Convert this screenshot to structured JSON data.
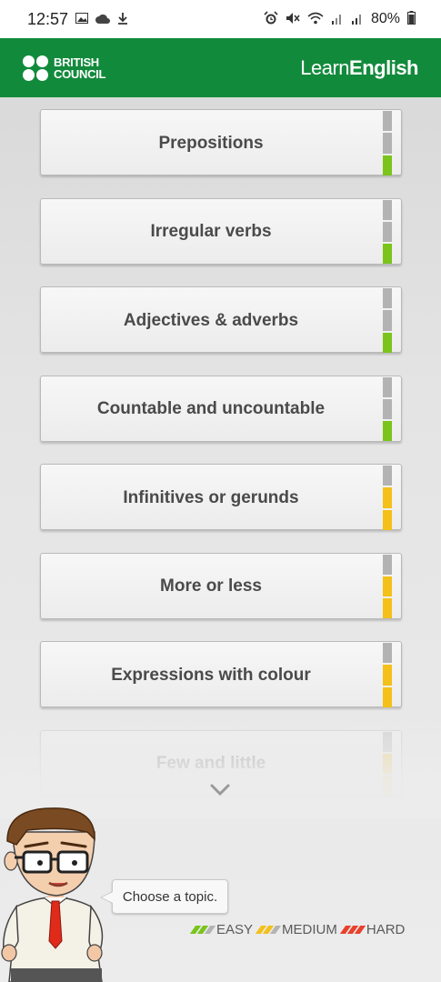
{
  "status_bar": {
    "time": "12:57",
    "battery": "80%",
    "left_icons": [
      "image-icon",
      "cloud-icon",
      "download-icon"
    ],
    "right_icons": [
      "alarm-icon",
      "mute-icon",
      "wifi-icon",
      "signal-icon",
      "signal-icon",
      "battery-icon"
    ]
  },
  "header": {
    "brand_line1": "BRITISH",
    "brand_line2": "COUNCIL",
    "app_title_light": "Learn",
    "app_title_bold": "English",
    "bg_color": "#128a3c"
  },
  "topics": [
    {
      "label": "Prepositions",
      "level": "easy"
    },
    {
      "label": "Irregular verbs",
      "level": "easy"
    },
    {
      "label": "Adjectives & adverbs",
      "level": "easy"
    },
    {
      "label": "Countable and uncountable",
      "level": "easy"
    },
    {
      "label": "Infinitives or gerunds",
      "level": "medium"
    },
    {
      "label": "More or less",
      "level": "medium"
    },
    {
      "label": "Expressions with colour",
      "level": "medium"
    },
    {
      "label": "Few and little",
      "level": "medium"
    }
  ],
  "level_colors": {
    "easy": "#7ac41b",
    "medium": "#f4c01a",
    "hard": "#e8412c",
    "empty": "#b3b3b3"
  },
  "mascot": {
    "speech": "Choose a topic."
  },
  "legend": {
    "easy": "EASY",
    "medium": "MEDIUM",
    "hard": "HARD"
  }
}
